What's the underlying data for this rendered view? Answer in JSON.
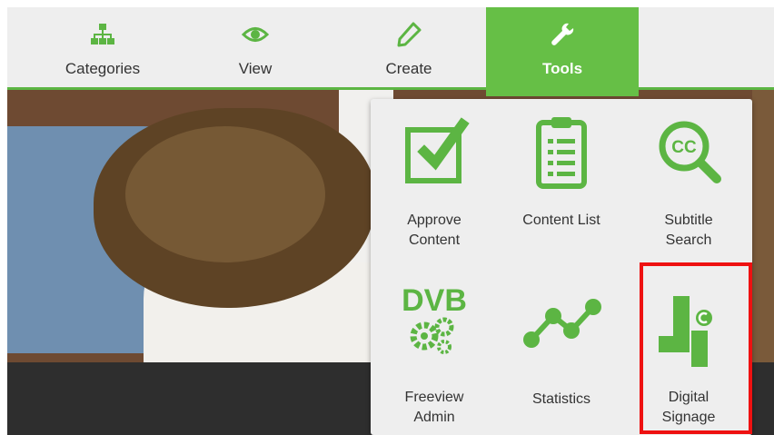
{
  "nav": {
    "items": [
      {
        "label": "Categories",
        "icon": "sitemap-icon"
      },
      {
        "label": "View",
        "icon": "eye-icon"
      },
      {
        "label": "Create",
        "icon": "pencil-icon"
      },
      {
        "label": "Tools",
        "icon": "wrench-icon",
        "active": true
      }
    ]
  },
  "tools": {
    "items": [
      {
        "label_line1": "Approve",
        "label_line2": "Content",
        "icon": "approve-checkbox-icon"
      },
      {
        "label_line1": "Content List",
        "label_line2": "",
        "icon": "clipboard-list-icon"
      },
      {
        "label_line1": "Subtitle",
        "label_line2": "Search",
        "icon": "cc-search-icon"
      },
      {
        "label_line1": "Freeview",
        "label_line2": "Admin",
        "icon": "dvb-gears-icon"
      },
      {
        "label_line1": "Statistics",
        "label_line2": "",
        "icon": "line-chart-icon"
      },
      {
        "label_line1": "Digital",
        "label_line2": "Signage",
        "icon": "digital-signage-icon"
      }
    ],
    "icon_text": {
      "cc": "CC",
      "dvb": "DVB"
    }
  },
  "colors": {
    "accent": "#66bf46",
    "icon_green": "#5cb543",
    "highlight": "#ee1111",
    "panel_bg": "#eeeeee"
  }
}
